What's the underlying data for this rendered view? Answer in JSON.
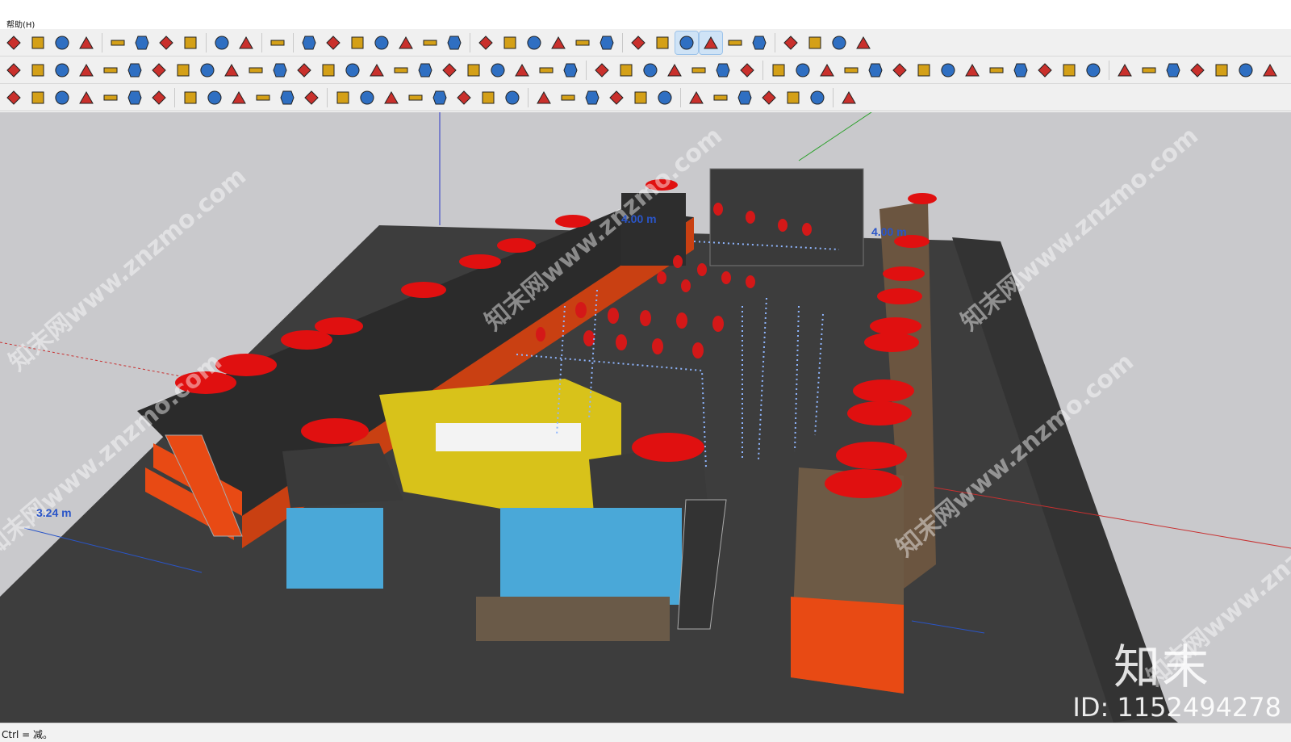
{
  "menubar": {
    "help_label": "帮助(H)"
  },
  "toolbars": {
    "row1": [
      "extension-warehouse-icon",
      "refresh-icon",
      "layout-icon",
      "add-icon",
      "tree-icon",
      "section-icon",
      "checker-icon",
      "cloud-upload-icon",
      "settings-icon",
      "mail-icon",
      "info-icon",
      "user-icon",
      "paint-icon",
      "grid-paint-icon",
      "push-pull-icon",
      "roof-icon",
      "bucket-icon",
      "hatch-icon",
      "tilt-icon",
      "solid-1-icon",
      "solid-2-icon",
      "solid-3-icon",
      "solid-4-icon",
      "solid-5-icon",
      "stack-icon",
      "box-icon",
      "cloud-sync-icon",
      "cloud-search-icon",
      "cloud-1-icon",
      "cloud-2-icon",
      "frame-icon",
      "network-icon",
      "rotate-icon",
      "chrome-icon"
    ],
    "row2": [
      "cylinder-icon",
      "cylinder-2-icon",
      "pipe-icon",
      "pipe-2-icon",
      "joint-icon",
      "curve-icon",
      "link-icon",
      "path-1-icon",
      "path-2-icon",
      "path-3-icon",
      "stairs-icon",
      "drop-icon",
      "align-icon",
      "arch-icon",
      "bar-icon",
      "plank-icon",
      "crate-icon",
      "gear-icon",
      "shield-icon",
      "shield-2-icon",
      "bell-icon",
      "recycle-icon",
      "shape-icon",
      "arrow-up-icon",
      "basket-icon",
      "house-1-icon",
      "door-icon",
      "house-2-icon",
      "house-3-icon",
      "house-4-icon",
      "house-5-icon",
      "clipboard-icon",
      "pencil-icon",
      "export-dxf-icon",
      "import-icon",
      "bulb-icon",
      "cube-wire-icon",
      "cube-icon",
      "magnify-icon",
      "gear-2-icon",
      "palette-1-icon",
      "palette-2-icon",
      "palette-3-icon",
      "palette-4-icon",
      "materials-icon",
      "layers-icon",
      "add-layer-icon",
      "sync-layer-icon",
      "scenes-icon",
      "scenes-2-icon",
      "eye-icon",
      "redeye-icon"
    ],
    "row3": [
      "box-yellow-icon",
      "box-green-icon",
      "box-gray-icon",
      "vertex-icon",
      "wave-icon",
      "wand-icon",
      "crop-icon",
      "triangle-icon",
      "axis-x-icon",
      "axis-y-icon",
      "axis-z-icon",
      "axis-r-icon",
      "axis-v-icon",
      "slash-icon",
      "iso-1-icon",
      "iso-2-icon",
      "bridge-icon",
      "leaf-icon",
      "corner-icon",
      "s-curve-icon",
      "s-curve-2-icon",
      "union-icon",
      "subtract-icon",
      "intersect-icon",
      "trim-icon",
      "split-icon",
      "outer-shell-icon",
      "grid-box-icon",
      "grid-box-2-icon",
      "terrain-1-icon",
      "terrain-2-icon",
      "book-icon",
      "book-2-icon",
      "plugin-icon"
    ]
  },
  "viewport": {
    "watermark_text": "知末网www.znzmo.com",
    "dimensions": [
      "4.00 m",
      "4.00 m",
      "3.24 m"
    ],
    "brand": "知末",
    "image_id": "ID: 1152494278",
    "colors": {
      "ground": "#3c3c3c",
      "sky": "#c9c9cc",
      "umbrella": "#e01010",
      "container_orange": "#e84a14",
      "container_yellow": "#d8c21a",
      "container_blue": "#4aa8d8",
      "lantern": "#d41818"
    }
  },
  "statusbar": {
    "text": "Ctrl = 减。"
  }
}
